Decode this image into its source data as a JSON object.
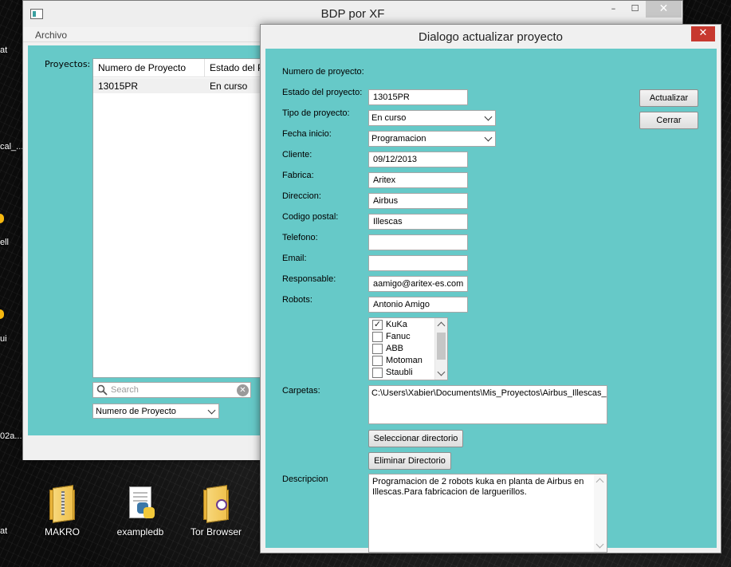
{
  "desktop": {
    "edge_labels": [
      "at",
      "cal_...",
      "ell",
      "ui",
      "02a..."
    ],
    "icons": [
      {
        "label": "MAKRO",
        "icon": "zip-folder-icon"
      },
      {
        "label": "exampledb",
        "icon": "python-file-icon"
      },
      {
        "label": "Tor Browser",
        "icon": "folder-icon"
      }
    ],
    "bottom_left_label": "at"
  },
  "main_window": {
    "title": "BDP por XF",
    "menu": [
      "Archivo"
    ],
    "controls": {
      "minimize": "–",
      "maximize": "☐",
      "close": "✕"
    },
    "projects_label": "Proyectos:",
    "table": {
      "columns": [
        "Numero de Proyecto",
        "Estado del P"
      ],
      "rows": [
        [
          "13015PR",
          "En curso"
        ]
      ]
    },
    "search_placeholder": "Search",
    "sort_by": "Numero de Proyecto"
  },
  "dialog": {
    "title": "Dialogo actualizar proyecto",
    "close_glyph": "✕",
    "fields": {
      "numero_label": "Numero de proyecto:",
      "numero_value": "13015PR",
      "estado_label": "Estado del proyecto:",
      "estado_value": "En curso",
      "tipo_label": "Tipo de proyecto:",
      "tipo_value": "Programacion",
      "fecha_label": "Fecha inicio:",
      "fecha_value": "09/12/2013",
      "cliente_label": "Cliente:",
      "cliente_value": "Aritex",
      "fabrica_label": "Fabrica:",
      "fabrica_value": "Airbus",
      "direccion_label": "Direccion:",
      "direccion_value": "Illescas",
      "codigo_label": "Codigo postal:",
      "codigo_value": "",
      "telefono_label": "Telefono:",
      "telefono_value": "",
      "email_label": "Email:",
      "email_value": "aamigo@aritex-es.com",
      "responsable_label": "Responsable:",
      "responsable_value": "Antonio Amigo",
      "robots_label": "Robots:",
      "carpetas_label": "Carpetas:",
      "descripcion_label": "Descripcion"
    },
    "robots": [
      {
        "name": "KuKa",
        "checked": true
      },
      {
        "name": "Fanuc",
        "checked": false
      },
      {
        "name": "ABB",
        "checked": false
      },
      {
        "name": "Motoman",
        "checked": false
      },
      {
        "name": "Staubli",
        "checked": false
      }
    ],
    "carpetas": [
      "C:\\Users\\Xabier\\Documents\\Mis_Proyectos\\Airbus_Illescas_Ba"
    ],
    "descripcion": "Programacion de 2 robots kuka en planta de Airbus en Illescas.Para fabricacion de larguerillos.",
    "buttons": {
      "actualizar": "Actualizar",
      "cerrar": "Cerrar",
      "seleccionar": "Seleccionar directorio",
      "eliminar": "Eliminar Directorio"
    }
  }
}
